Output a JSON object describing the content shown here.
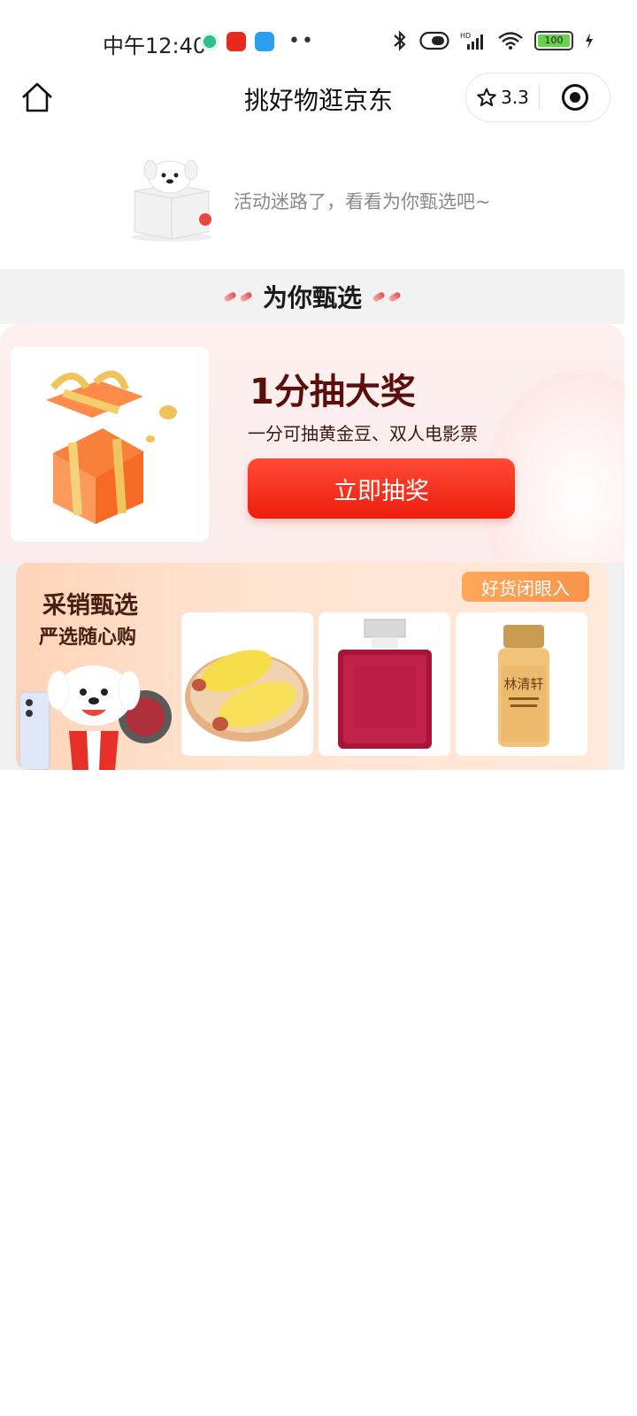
{
  "status_bar": {
    "time": "中午12:40",
    "battery": "100"
  },
  "nav": {
    "title": "挑好物逛京东",
    "rating": "3.3"
  },
  "notice": {
    "text": "活动迷路了，看看为你甄选吧~"
  },
  "section": {
    "title": "为你甄选"
  },
  "lottery": {
    "title": "1分抽大奖",
    "subtitle": "一分可抽黄金豆、双人电影票",
    "button_label": "立即抽奖"
  },
  "promo": {
    "title": "采销甄选",
    "subtitle": "严选随心购",
    "badge": "好货闭眼入",
    "items": [
      {
        "name": "corn-sausage-bread-image"
      },
      {
        "name": "perfume-image"
      },
      {
        "name": "essence-bottle-image",
        "label": "林清轩"
      }
    ]
  },
  "colors": {
    "accent_red": "#ee1d0d",
    "promo_orange": "#f7934a",
    "lottery_title": "#5a0f0c"
  }
}
